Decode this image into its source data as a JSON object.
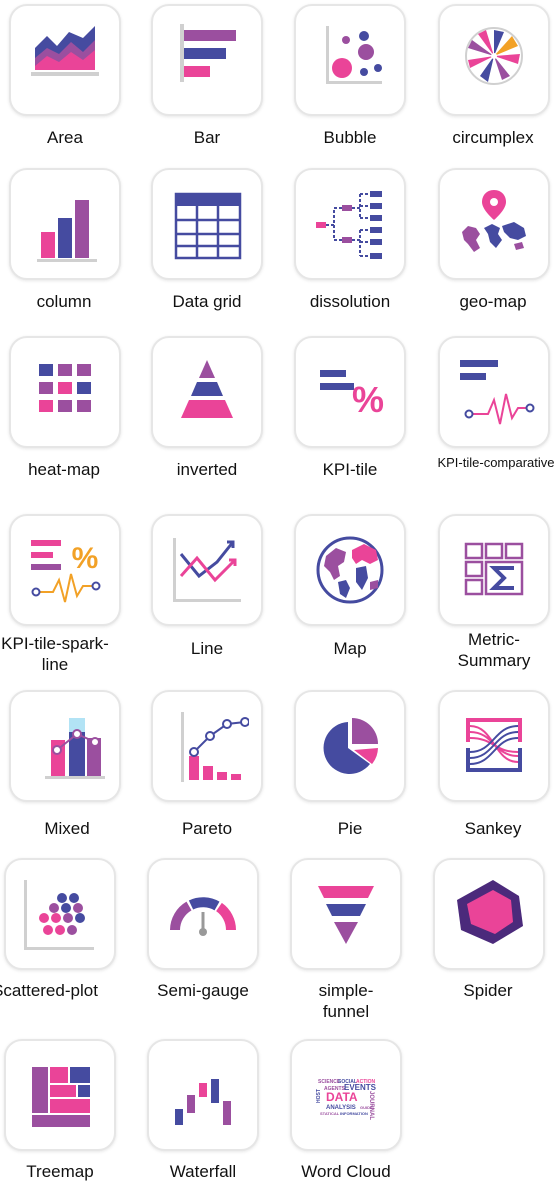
{
  "colors": {
    "purple": "#9b4f9f",
    "blue": "#454ba0",
    "pink": "#ea4498",
    "gray": "#d0d0d0",
    "orange": "#f2a126"
  },
  "items": [
    {
      "label": "Area",
      "icon": "area-chart-icon"
    },
    {
      "label": "Bar",
      "icon": "bar-chart-icon"
    },
    {
      "label": "Bubble",
      "icon": "bubble-chart-icon"
    },
    {
      "label": "circumplex",
      "icon": "circumplex-chart-icon"
    },
    {
      "label": "column",
      "icon": "column-chart-icon"
    },
    {
      "label": "Data grid",
      "icon": "data-grid-icon"
    },
    {
      "label": "dissolution",
      "icon": "dissolution-tree-icon"
    },
    {
      "label": "geo-map",
      "icon": "geo-map-icon"
    },
    {
      "label": "heat-map",
      "icon": "heat-map-icon"
    },
    {
      "label": "inverted",
      "icon": "inverted-pyramid-icon"
    },
    {
      "label": "KPI-tile",
      "icon": "kpi-tile-icon"
    },
    {
      "label": "KPI-tile-comparative",
      "icon": "kpi-tile-comparative-icon"
    },
    {
      "label": "KPI-tile-spark-line",
      "icon": "kpi-tile-spark-line-icon"
    },
    {
      "label": "Line",
      "icon": "line-chart-icon"
    },
    {
      "label": "Map",
      "icon": "world-map-icon"
    },
    {
      "label": "Metric-Summary",
      "icon": "metric-summary-icon"
    },
    {
      "label": "Mixed",
      "icon": "mixed-chart-icon"
    },
    {
      "label": "Pareto",
      "icon": "pareto-chart-icon"
    },
    {
      "label": "Pie",
      "icon": "pie-chart-icon"
    },
    {
      "label": "Sankey",
      "icon": "sankey-chart-icon"
    },
    {
      "label": "Scattered-plot",
      "icon": "scatter-plot-icon"
    },
    {
      "label": "Semi-gauge",
      "icon": "semi-gauge-icon"
    },
    {
      "label": "simple-funnel",
      "icon": "funnel-chart-icon"
    },
    {
      "label": "Spider",
      "icon": "spider-chart-icon"
    },
    {
      "label": "Treemap",
      "icon": "treemap-icon"
    },
    {
      "label": "Waterfall",
      "icon": "waterfall-chart-icon"
    },
    {
      "label": "Word Cloud",
      "icon": "word-cloud-icon"
    }
  ],
  "word_cloud_text": [
    "SCIENCE",
    "SOCIAL",
    "ACTION",
    "AGENTS",
    "EVENTS",
    "HOST",
    "DATA",
    "ANALYSIS",
    "GUIDE",
    "JOURNAL",
    "STATICAL",
    "INFORMATION"
  ]
}
